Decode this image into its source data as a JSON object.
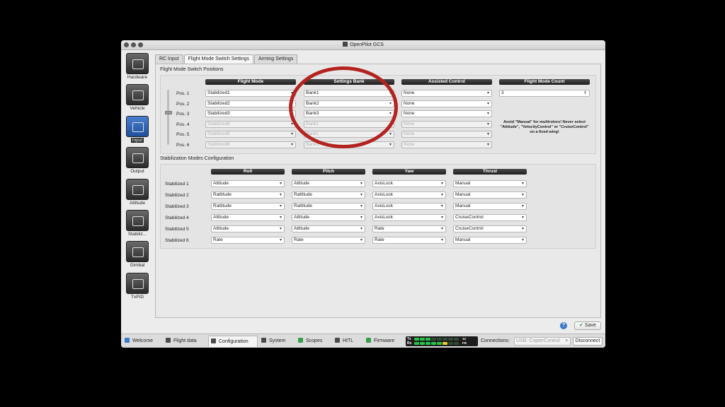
{
  "window": {
    "title": "OpenPilot GCS"
  },
  "sidebar": {
    "items": [
      {
        "label": "Hardware",
        "icon": "chip-icon"
      },
      {
        "label": "Vehicle",
        "icon": "vehicle-icon"
      },
      {
        "label": "Input",
        "icon": "transmitter-icon",
        "active": true
      },
      {
        "label": "Output",
        "icon": "motor-icon"
      },
      {
        "label": "Attitude",
        "icon": "attitude-icon"
      },
      {
        "label": "Stabiliz...",
        "icon": "stabilization-icon"
      },
      {
        "label": "Gimbal",
        "icon": "camera-icon"
      },
      {
        "label": "TxPID",
        "icon": "txpid-icon"
      }
    ]
  },
  "tabs": [
    {
      "label": "RC Input"
    },
    {
      "label": "Flight Mode Switch Settings",
      "active": true
    },
    {
      "label": "Arming Settings"
    }
  ],
  "fms": {
    "section_title": "Flight Mode Switch Positions",
    "headers": {
      "flight_mode": "Flight Mode",
      "settings_bank": "Settings Bank",
      "assisted": "Assisted Control",
      "count": "Flight Mode Count"
    },
    "rows": [
      {
        "pos": "Pos. 1",
        "mode": "Stabilized1",
        "bank": "Bank1",
        "assist": "None",
        "enabled": true
      },
      {
        "pos": "Pos. 2",
        "mode": "Stabilized2",
        "bank": "Bank2",
        "assist": "None",
        "enabled": true
      },
      {
        "pos": "Pos. 3",
        "mode": "Stabilized3",
        "bank": "Bank3",
        "assist": "None",
        "enabled": true
      },
      {
        "pos": "Pos. 4",
        "mode": "Stabilized4",
        "bank": "Bank1",
        "assist": "None",
        "enabled": false
      },
      {
        "pos": "Pos. 5",
        "mode": "Stabilized5",
        "bank": "Bank1",
        "assist": "None",
        "enabled": false
      },
      {
        "pos": "Pos. 6",
        "mode": "Stabilized6",
        "bank": "Bank1",
        "assist": "None",
        "enabled": false
      }
    ],
    "count_value": "3",
    "note": "Avoid \"Manual\" for multirotors! Never select \"Attitude\", \"VelocityControl\" or \"CruiseControl\" on a fixed wing!"
  },
  "stab": {
    "section_title": "Stabilization Modes Configuration",
    "headers": {
      "roll": "Roll",
      "pitch": "Pitch",
      "yaw": "Yaw",
      "thrust": "Thrust"
    },
    "rows": [
      {
        "label": "Stabilized 1",
        "roll": "Attitude",
        "pitch": "Attitude",
        "yaw": "AxisLock",
        "thrust": "Manual"
      },
      {
        "label": "Stabilized 2",
        "roll": "Rattitude",
        "pitch": "Rattitude",
        "yaw": "AxisLock",
        "thrust": "Manual"
      },
      {
        "label": "Stabilized 3",
        "roll": "Rattitude",
        "pitch": "Rattitude",
        "yaw": "AxisLock",
        "thrust": "Manual"
      },
      {
        "label": "Stabilized 4",
        "roll": "Attitude",
        "pitch": "Attitude",
        "yaw": "AxisLock",
        "thrust": "CruiseControl"
      },
      {
        "label": "Stabilized 5",
        "roll": "Attitude",
        "pitch": "Attitude",
        "yaw": "Rate",
        "thrust": "CruiseControl"
      },
      {
        "label": "Stabilized 6",
        "roll": "Rate",
        "pitch": "Rate",
        "yaw": "Rate",
        "thrust": "Manual"
      }
    ]
  },
  "actions": {
    "help": "?",
    "save": "Save"
  },
  "bottom": {
    "tabs": [
      {
        "label": "Welcome",
        "icon": "welcome-icon"
      },
      {
        "label": "Flight data",
        "icon": "flight-data-icon"
      },
      {
        "label": "Configuration",
        "icon": "configuration-icon",
        "active": true
      },
      {
        "label": "System",
        "icon": "system-icon"
      },
      {
        "label": "Scopes",
        "icon": "scopes-icon"
      },
      {
        "label": "HITL",
        "icon": "hitl-icon"
      },
      {
        "label": "Firmware",
        "icon": "firmware-icon"
      }
    ],
    "tx_label": "Tx",
    "rx_label": "Rx",
    "tx_num": "12",
    "rx_num": "FR",
    "connections_label": "Connections:",
    "connection_value": "USB: CopterControl",
    "disconnect": "Disconnect"
  },
  "colors": {
    "highlight_circle": "#b3231f",
    "header_bg": "#2a2a2a",
    "link_green": "#25c24a"
  }
}
